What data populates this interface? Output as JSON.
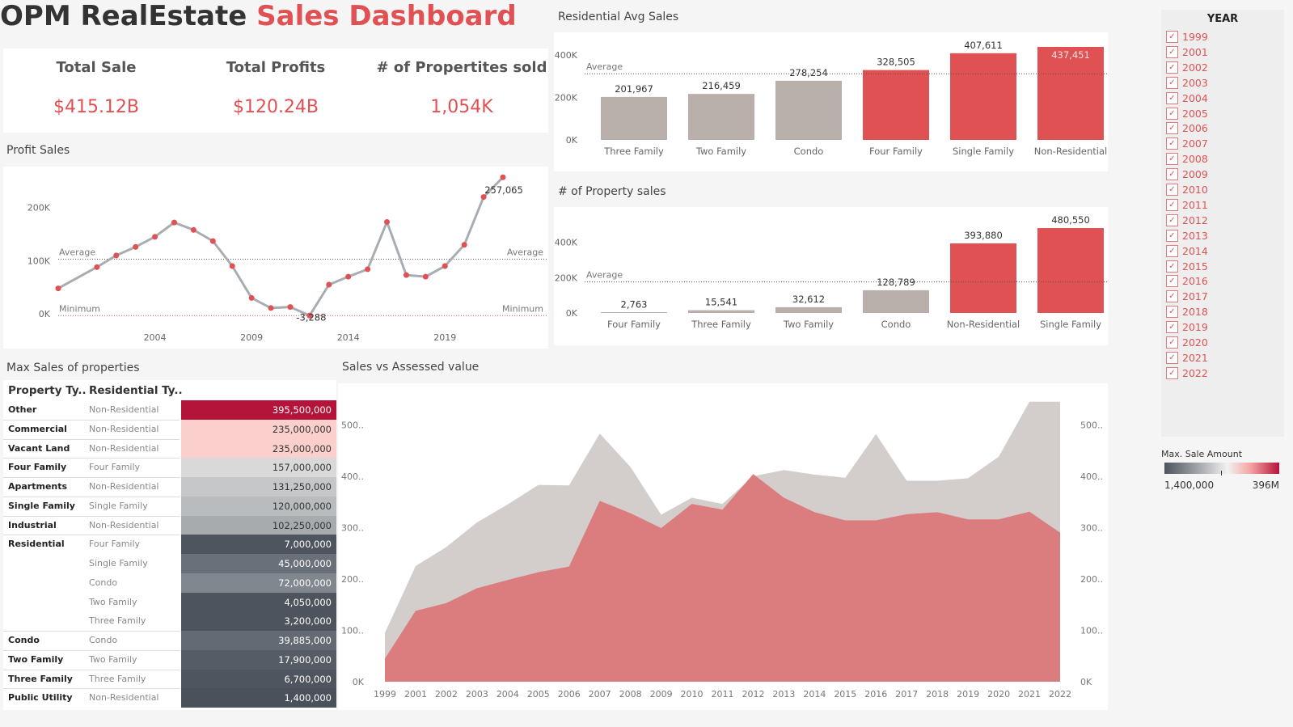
{
  "title": {
    "part1": "OPM  RealEstate",
    "part2": "Sales Dashboard"
  },
  "kpis": [
    {
      "label": "Total Sale",
      "value": "$415.12B"
    },
    {
      "label": "Total Profits",
      "value": "$120.24B"
    },
    {
      "label": "# of Propertites sold",
      "value": "1,054K"
    }
  ],
  "colors": {
    "accent": "#e05154",
    "grey_bar": "#bab0ab",
    "line": "#a7adb2",
    "dark_cell": "#4d545d",
    "top_cell": "#b5143a"
  },
  "year_filter": {
    "title": "YEAR",
    "years": [
      "1999",
      "2001",
      "2002",
      "2003",
      "2004",
      "2005",
      "2006",
      "2007",
      "2008",
      "2009",
      "2010",
      "2011",
      "2012",
      "2013",
      "2014",
      "2015",
      "2016",
      "2017",
      "2018",
      "2019",
      "2020",
      "2021",
      "2022"
    ]
  },
  "legend": {
    "title": "Max. Sale Amount",
    "min": "1,400,000",
    "max": "396M"
  },
  "chart_data": [
    {
      "id": "profit_sales",
      "type": "line",
      "title": "Profit Sales",
      "x": [
        1999,
        2001,
        2002,
        2003,
        2004,
        2005,
        2006,
        2007,
        2008,
        2009,
        2010,
        2011,
        2012,
        2013,
        2014,
        2015,
        2016,
        2017,
        2018,
        2019,
        2020,
        2021,
        2022
      ],
      "values": [
        48000,
        88000,
        110000,
        126000,
        145000,
        172000,
        158000,
        137000,
        90000,
        30000,
        11000,
        13000,
        -3288,
        55000,
        70000,
        84000,
        173000,
        73000,
        70000,
        90000,
        130000,
        220000,
        257065
      ],
      "x_ticks": [
        "2004",
        "2009",
        "2014",
        "2019"
      ],
      "y_ticks": [
        "0K",
        "100K",
        "200K"
      ],
      "ylim": [
        -15000,
        265000
      ],
      "reference_lines": [
        {
          "label": "Average",
          "value": 103000
        },
        {
          "label": "Minimum",
          "value": -3288
        }
      ],
      "data_labels": {
        "max": "257,065",
        "min": "-3,288"
      }
    },
    {
      "id": "residential_avg_sales",
      "type": "bar",
      "title": "Residential Avg Sales",
      "categories": [
        "Three Family",
        "Two Family",
        "Condo",
        "Four Family",
        "Single Family",
        "Non-Residential"
      ],
      "values": [
        201967,
        216459,
        278254,
        328505,
        407611,
        437451
      ],
      "labels": [
        "201,967",
        "216,459",
        "278,254",
        "328,505",
        "407,611",
        "437,451"
      ],
      "highlight": [
        false,
        false,
        false,
        true,
        true,
        true
      ],
      "y_ticks": [
        "0K",
        "200K",
        "400K"
      ],
      "ylim": [
        0,
        445000
      ],
      "reference_lines": [
        {
          "label": "Average",
          "value": 311000
        }
      ]
    },
    {
      "id": "property_sales_count",
      "type": "bar",
      "title": "# of Property sales",
      "categories": [
        "Four Family",
        "Three Family",
        "Two Family",
        "Condo",
        "Non-Residential",
        "Single Family"
      ],
      "values": [
        2763,
        15541,
        32612,
        128789,
        393880,
        480550
      ],
      "labels": [
        "2,763",
        "15,541",
        "32,612",
        "128,789",
        "393,880",
        "480,550"
      ],
      "highlight": [
        false,
        false,
        false,
        false,
        true,
        true
      ],
      "y_ticks": [
        "0K",
        "200K",
        "400K"
      ],
      "ylim": [
        0,
        490000
      ],
      "reference_lines": [
        {
          "label": "Average",
          "value": 176000
        }
      ]
    },
    {
      "id": "max_sales_table",
      "type": "table",
      "title": "Max Sales of properties",
      "columns": [
        "Property Ty..",
        "Residential Ty.."
      ],
      "rows": [
        {
          "property": "Other",
          "residential": "Non-Residential",
          "value": "395,500,000",
          "bg": "#b5143a",
          "fg": "#ffffff"
        },
        {
          "property": "Commercial",
          "residential": "Non-Residential",
          "value": "235,000,000",
          "bg": "#fbcfcb",
          "fg": "#333333"
        },
        {
          "property": "Vacant Land",
          "residential": "Non-Residential",
          "value": "235,000,000",
          "bg": "#fbcfcb",
          "fg": "#333333"
        },
        {
          "property": "Four Family",
          "residential": "Four Family",
          "value": "157,000,000",
          "bg": "#d9d9d9",
          "fg": "#333333"
        },
        {
          "property": "Apartments",
          "residential": "Non-Residential",
          "value": "131,250,000",
          "bg": "#c5c7c8",
          "fg": "#333333"
        },
        {
          "property": "Single Family",
          "residential": "Single Family",
          "value": "120,000,000",
          "bg": "#b9bcbe",
          "fg": "#333333"
        },
        {
          "property": "Industrial",
          "residential": "Non-Residential",
          "value": "102,250,000",
          "bg": "#a8abae",
          "fg": "#333333"
        },
        {
          "property": "Residential",
          "residential": "Four Family",
          "value": "7,000,000",
          "bg": "#4e555e",
          "fg": "#ffffff"
        },
        {
          "property": "",
          "residential": "Single Family",
          "value": "45,000,000",
          "bg": "#69707a",
          "fg": "#ffffff"
        },
        {
          "property": "",
          "residential": "Condo",
          "value": "72,000,000",
          "bg": "#80878e",
          "fg": "#ffffff"
        },
        {
          "property": "",
          "residential": "Two Family",
          "value": "4,050,000",
          "bg": "#4d545d",
          "fg": "#ffffff"
        },
        {
          "property": "",
          "residential": "Three Family",
          "value": "3,200,000",
          "bg": "#4d545d",
          "fg": "#ffffff"
        },
        {
          "property": "Condo",
          "residential": "Condo",
          "value": "39,885,000",
          "bg": "#636a73",
          "fg": "#ffffff"
        },
        {
          "property": "Two Family",
          "residential": "Two Family",
          "value": "17,900,000",
          "bg": "#555c65",
          "fg": "#ffffff"
        },
        {
          "property": "Three Family",
          "residential": "Three Family",
          "value": "6,700,000",
          "bg": "#4e555e",
          "fg": "#ffffff"
        },
        {
          "property": "Public Utility",
          "residential": "Non-Residential",
          "value": "1,400,000",
          "bg": "#4a515a",
          "fg": "#ffffff"
        }
      ]
    },
    {
      "id": "sales_vs_assessed",
      "type": "area",
      "title": "Sales vs Assessed value",
      "x": [
        "1999",
        "2001",
        "2002",
        "2003",
        "2004",
        "2005",
        "2006",
        "2007",
        "2008",
        "2009",
        "2010",
        "2011",
        "2012",
        "2013",
        "2014",
        "2015",
        "2016",
        "2017",
        "2018",
        "2019",
        "2020",
        "2021",
        "2022"
      ],
      "series": [
        {
          "values": [
            95,
            225,
            262,
            310,
            345,
            383,
            382,
            483,
            418,
            325,
            358,
            346,
            400,
            412,
            403,
            397,
            482,
            391,
            391,
            396,
            438,
            545,
            545
          ],
          "color": "#d3cdcb"
        },
        {
          "values": [
            45,
            138,
            153,
            182,
            198,
            213,
            224,
            352,
            328,
            299,
            346,
            335,
            404,
            358,
            330,
            314,
            314,
            326,
            330,
            316,
            316,
            331,
            290
          ],
          "color": "#db7c7e"
        }
      ],
      "y_ticks": [
        "0K",
        "100..",
        "200..",
        "300..",
        "400..",
        "500.."
      ],
      "ylim": [
        0,
        565
      ]
    }
  ]
}
